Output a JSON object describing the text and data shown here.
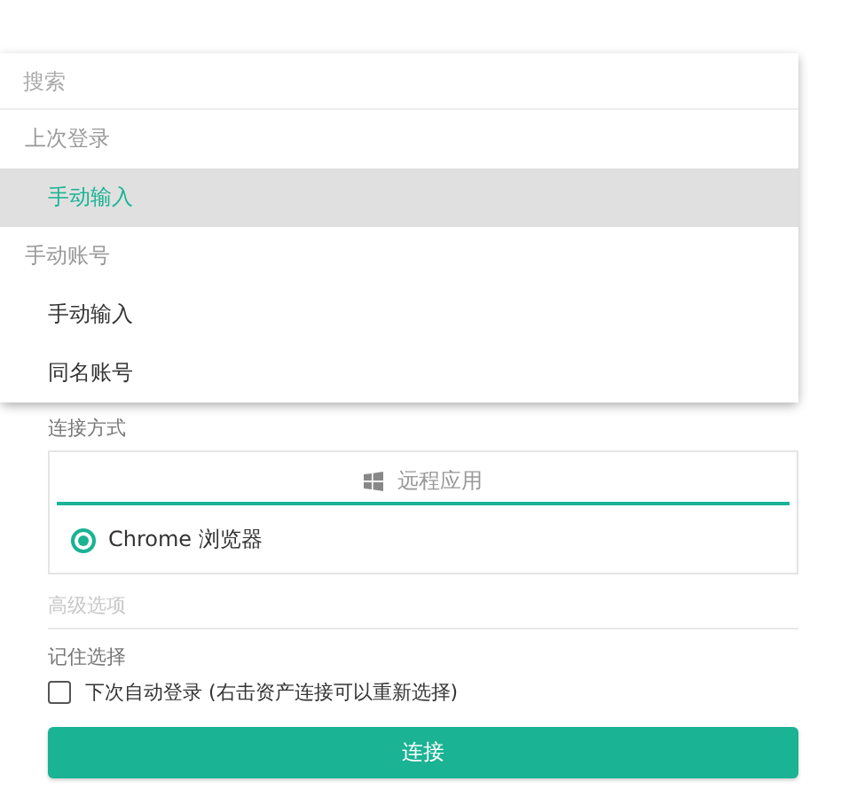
{
  "menu": {
    "search": {
      "placeholder": "搜索"
    },
    "groups": [
      {
        "label": "上次登录",
        "items": [
          {
            "label": "手动输入",
            "selected": true
          }
        ]
      },
      {
        "label": "手动账号",
        "items": [
          {
            "label": "手动输入",
            "selected": false
          },
          {
            "label": "同名账号",
            "selected": false
          }
        ]
      }
    ]
  },
  "connect_method": {
    "label": "连接方式",
    "tabs": [
      {
        "label": "远程应用",
        "selected": true
      }
    ],
    "options": [
      {
        "label": "Chrome 浏览器",
        "selected": true
      }
    ]
  },
  "advanced": {
    "label": "高级选项"
  },
  "remember": {
    "label": "记住选择",
    "checkbox": {
      "label": "下次自动登录 (右击资产连接可以重新选择)",
      "checked": false
    }
  },
  "submit": {
    "label": "连接"
  }
}
